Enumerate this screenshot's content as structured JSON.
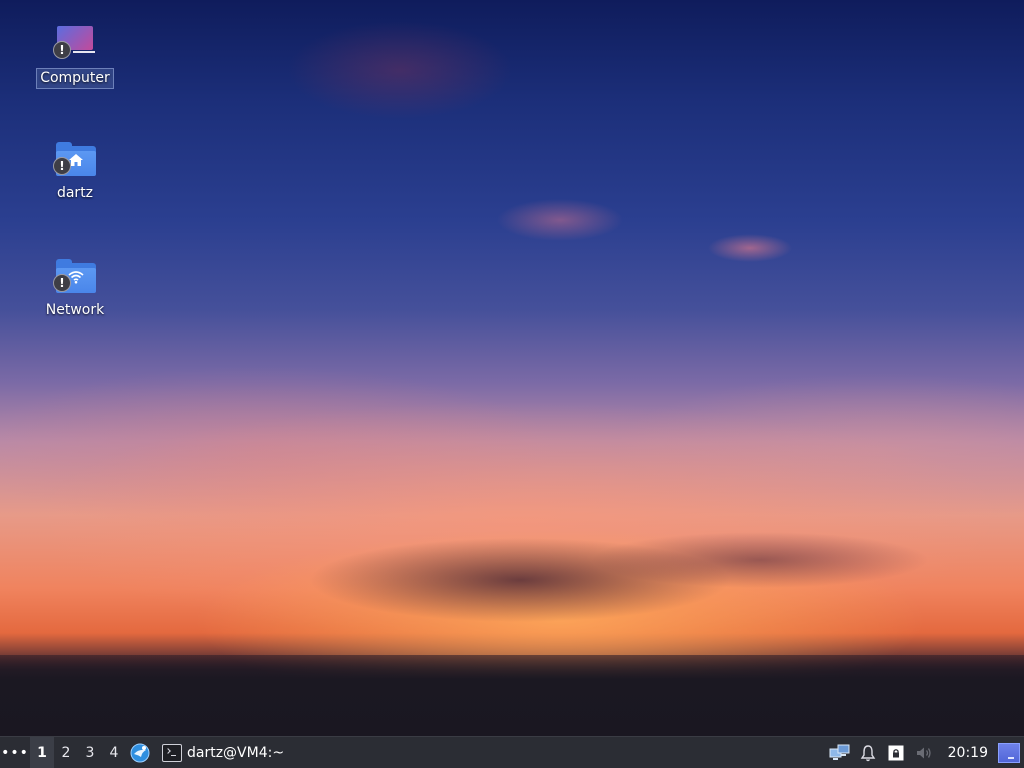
{
  "desktop": {
    "icons": [
      {
        "label": "Computer",
        "icon": "computer-icon",
        "badge": "!"
      },
      {
        "label": "dartz",
        "icon": "home-folder-icon",
        "badge": "!"
      },
      {
        "label": "Network",
        "icon": "network-folder-icon",
        "badge": "!"
      }
    ]
  },
  "taskbar": {
    "menu_label": "•••",
    "workspaces": [
      "1",
      "2",
      "3",
      "4"
    ],
    "active_workspace": "1",
    "launcher_icon": "browser-icon",
    "task": {
      "label": "dartz@VM4:~",
      "icon": "terminal-icon"
    },
    "tray": {
      "icons": [
        "network-status-icon",
        "notifications-icon",
        "lock-icon",
        "volume-muted-icon"
      ],
      "clock": "20:19",
      "show_desktop_icon": "show-desktop-icon"
    }
  },
  "colors": {
    "taskbar_bg": "#2b2d34",
    "folder_blue": "#4a86ea",
    "accent": "#5166d8"
  }
}
